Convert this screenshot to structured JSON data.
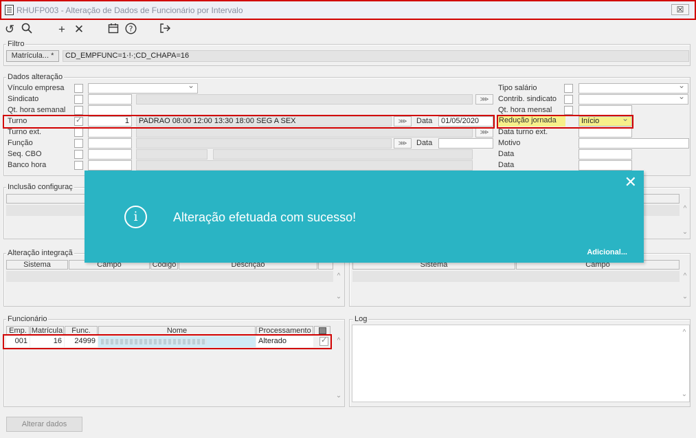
{
  "window": {
    "title": "RHUFP003 - Alteração de Dados de Funcionário por Intervalo",
    "close": "☒"
  },
  "toolbar": {
    "icons": [
      "refresh-icon",
      "search-icon",
      "add-icon",
      "delete-icon",
      "calendar-icon",
      "help-icon",
      "exit-icon"
    ]
  },
  "filtro": {
    "label": "Filtro",
    "button": "Matrícula... *",
    "value": "CD_EMPFUNC=1·!·;CD_CHAPA=16"
  },
  "dados": {
    "label": "Dados alteração",
    "vinculo": "Vínculo empresa",
    "sindicato": "Sindicato",
    "qt_semanal": "Qt. hora semanal",
    "turno": "Turno",
    "turno_val": "1",
    "turno_desc": "PADRAO 08:00 12:00 13:30 18:00 SEG A SEX",
    "data_label": "Data",
    "data_val": "01/05/2020",
    "turno_ext": "Turno ext.",
    "funcao": "Função",
    "data_label2": "Data",
    "seq_cbo": "Seq. CBO",
    "banco_hora": "Banco hora",
    "tipo_salario": "Tipo salário",
    "contrib": "Contrib. sindicato",
    "qt_mensal": "Qt. hora mensal",
    "reducao": "Redução jornada",
    "reducao_val": "Início",
    "data_turno_ext": "Data turno ext.",
    "motivo": "Motivo",
    "data1": "Data",
    "data2": "Data"
  },
  "inclusao": {
    "label": "Inclusão configuraç"
  },
  "integracao": {
    "label": "Alteração integraçã",
    "cols": [
      "Sistema",
      "Campo",
      "Código",
      "Descrição"
    ],
    "right_cols": [
      "Sistema",
      "Campo"
    ]
  },
  "funcionario": {
    "label": "Funcionário",
    "cols": [
      "Emp.",
      "Matrícula",
      "Func.",
      "Nome",
      "Processamento"
    ],
    "row": {
      "emp": "001",
      "matricula": "16",
      "func": "24999",
      "processamento": "Alterado"
    }
  },
  "log": {
    "label": "Log"
  },
  "footer": {
    "button": "Alterar dados"
  },
  "toast": {
    "message": "Alteração efetuada com sucesso!",
    "more": "Adicional...",
    "close": "✕",
    "icon": "i"
  },
  "colors": {
    "highlight": "#d10000",
    "toast": "#2ab4c4",
    "reducao_bg": "#f7f08a"
  }
}
